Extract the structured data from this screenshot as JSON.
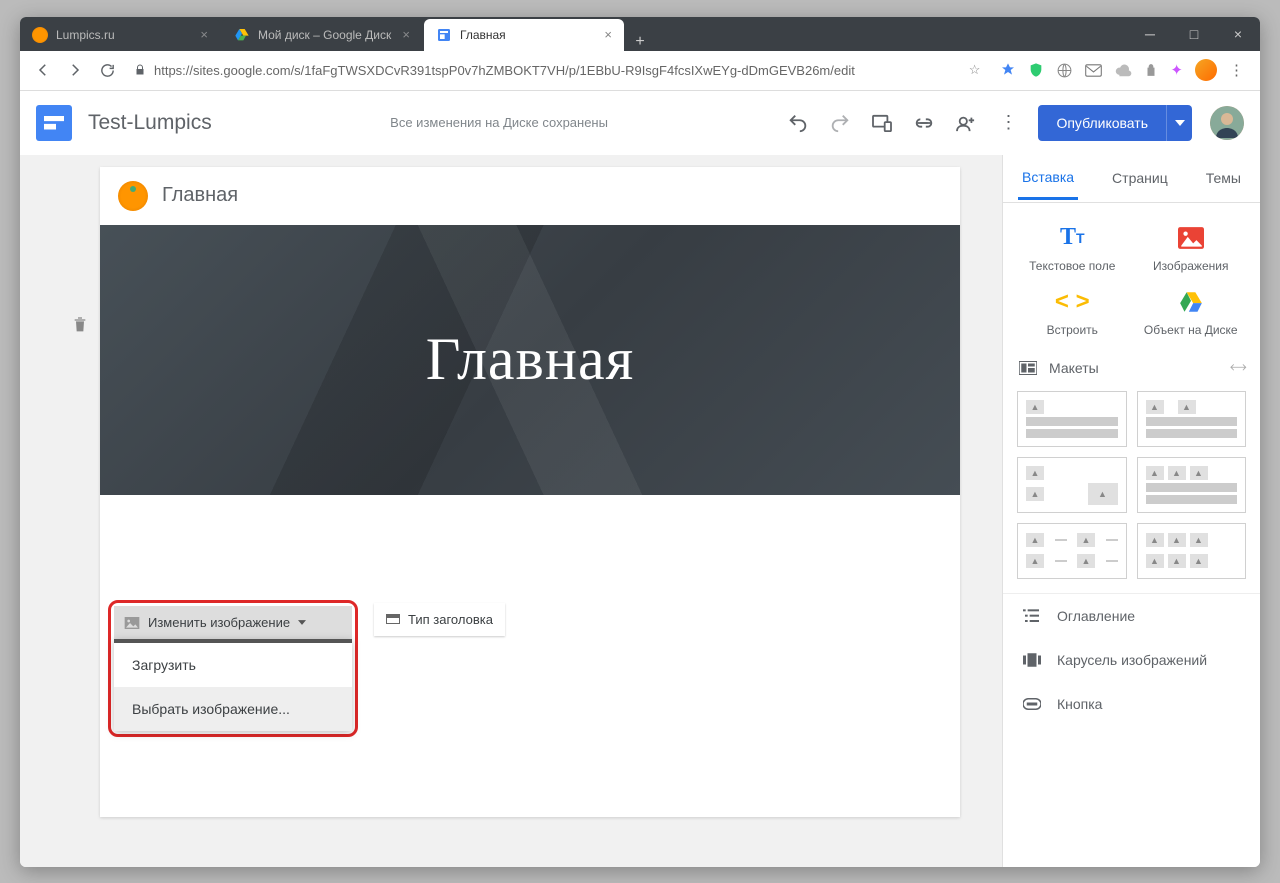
{
  "browser": {
    "tabs": [
      {
        "label": "Lumpics.ru"
      },
      {
        "label": "Мой диск – Google Диск"
      },
      {
        "label": "Главная"
      }
    ],
    "url": "https://sites.google.com/s/1faFgTWSXDCvR391tspP0v7hZMBOKT7VH/p/1EBbU-R9IsgF4fcsIXwEYg-dDmGEVB26m/edit"
  },
  "app": {
    "siteTitle": "Test-Lumpics",
    "saveStatus": "Все изменения на Диске сохранены",
    "publish": "Опубликовать"
  },
  "page": {
    "navTitle": "Главная",
    "heroTitle": "Главная",
    "changeImageBtn": "Изменить изображение",
    "headerTypeBtn": "Тип заголовка",
    "dropdown": {
      "upload": "Загрузить",
      "select": "Выбрать изображение..."
    }
  },
  "panel": {
    "tabs": {
      "insert": "Вставка",
      "pages": "Страниц",
      "themes": "Темы"
    },
    "insert": {
      "textBox": "Текстовое поле",
      "images": "Изображения",
      "embed": "Встроить",
      "drive": "Объект на Диске"
    },
    "layoutsHead": "Макеты",
    "components": {
      "toc": "Оглавление",
      "carousel": "Карусель изображений",
      "button": "Кнопка"
    }
  }
}
